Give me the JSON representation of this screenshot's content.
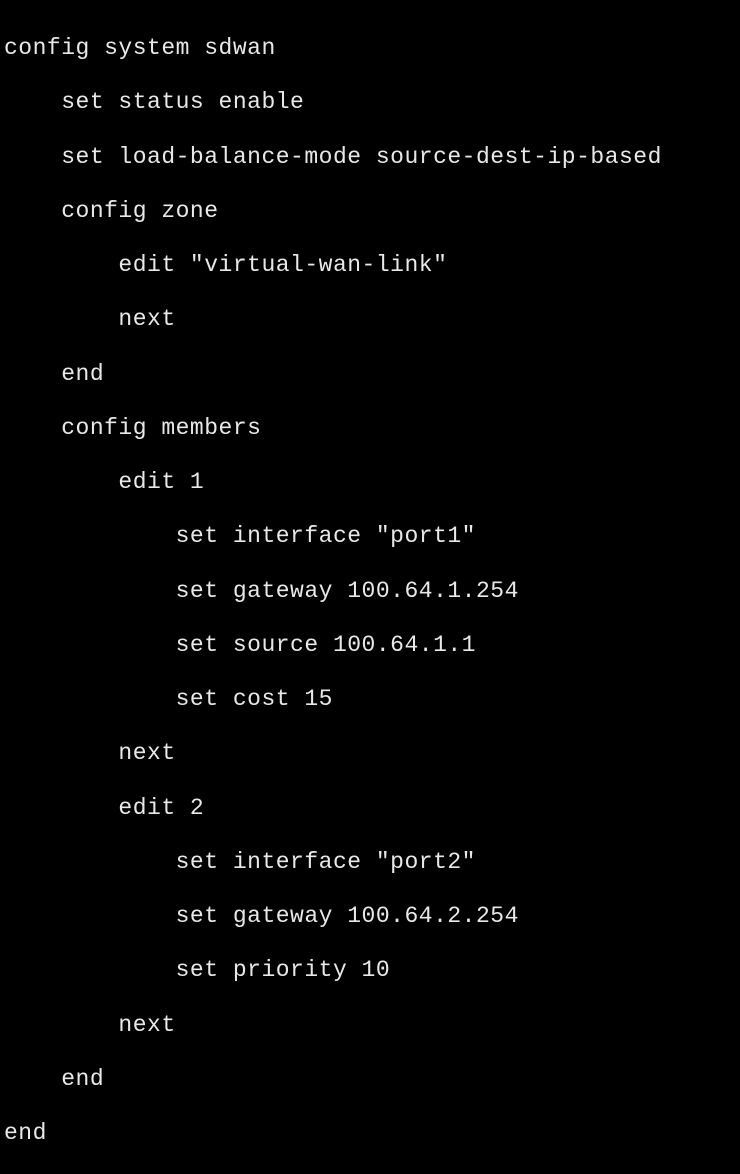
{
  "config": {
    "line1": "config system sdwan",
    "line2": "    set status enable",
    "line3": "    set load-balance-mode source-dest-ip-based",
    "line4": "    config zone",
    "line5": "        edit \"virtual-wan-link\"",
    "line6": "        next",
    "line7": "    end",
    "line8": "    config members",
    "line9": "        edit 1",
    "line10": "            set interface \"port1\"",
    "line11": "            set gateway 100.64.1.254",
    "line12": "            set source 100.64.1.1",
    "line13": "            set cost 15",
    "line14": "        next",
    "line15": "        edit 2",
    "line16": "            set interface \"port2\"",
    "line17": "            set gateway 100.64.2.254",
    "line18": "            set priority 10",
    "line19": "        next",
    "line20": "    end",
    "line21": "end"
  }
}
